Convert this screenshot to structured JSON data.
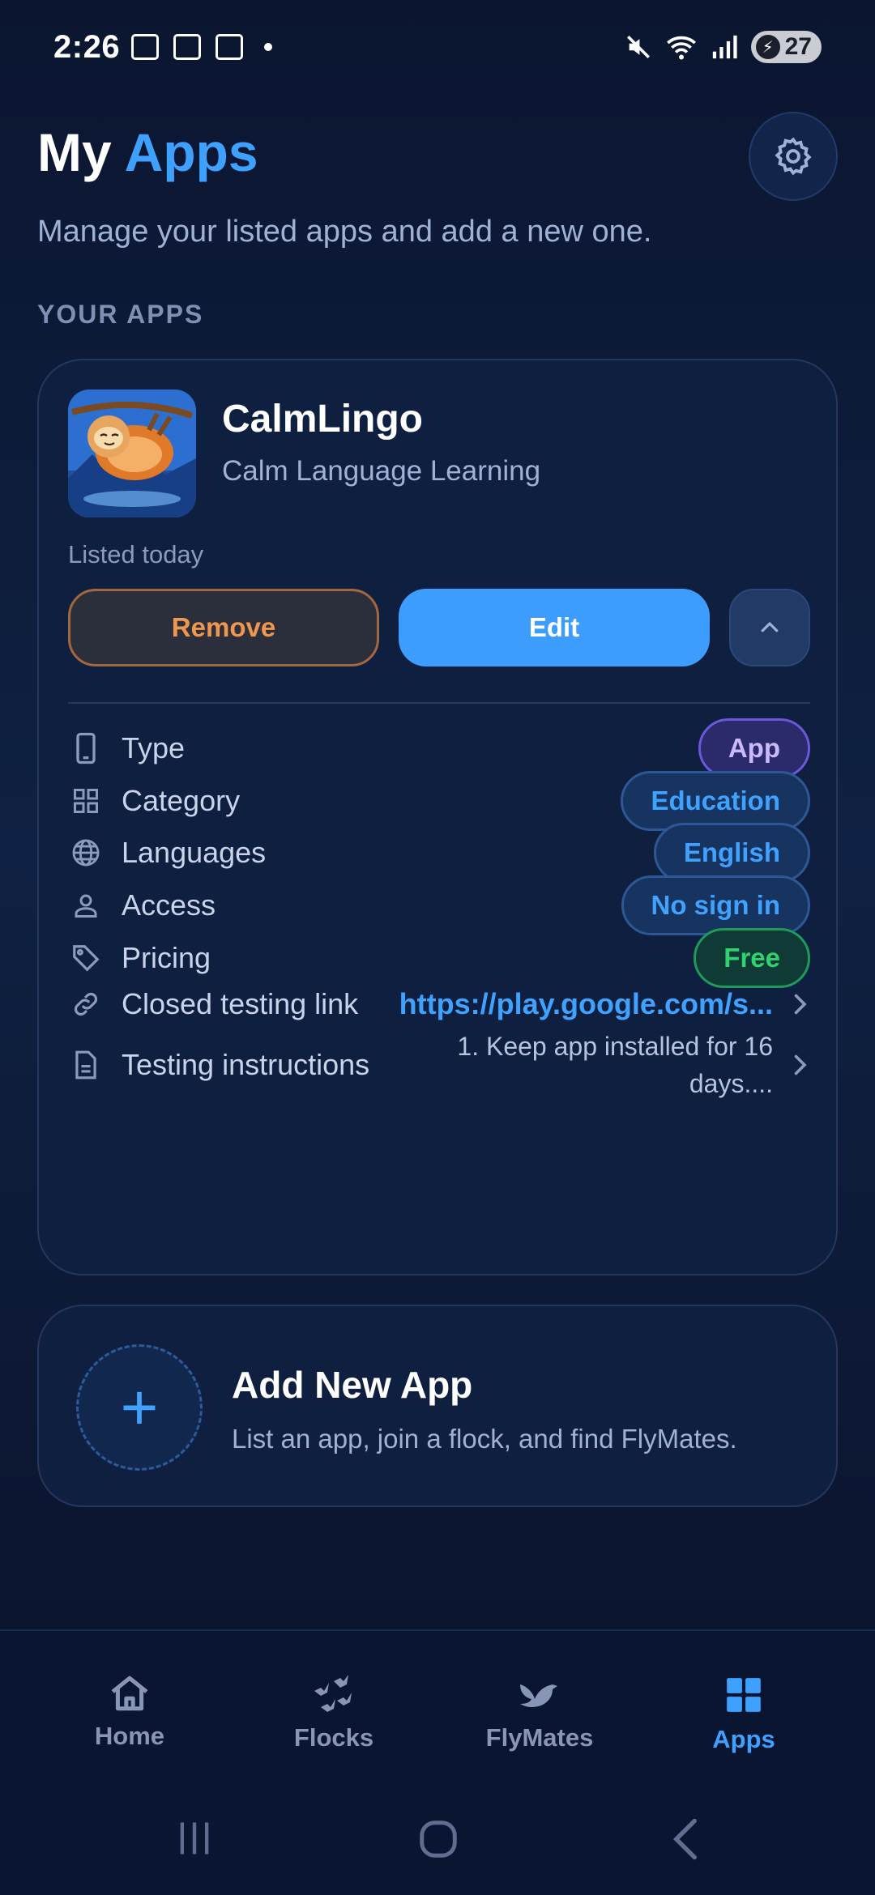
{
  "status_bar": {
    "time": "2:26",
    "battery": "27",
    "icons": [
      "screenshot-icon",
      "copy-icon",
      "calendar-icon",
      "notification-dot",
      "mute-icon",
      "wifi-icon",
      "signal-icon",
      "battery-icon"
    ]
  },
  "header": {
    "title_part1": "My",
    "title_part2": "Apps",
    "subtitle": "Manage your listed apps and add a new one.",
    "settings_icon": "gear-icon"
  },
  "section_label": "YOUR APPS",
  "app": {
    "name": "CalmLingo",
    "tagline": "Calm Language Learning",
    "listed": "Listed today",
    "remove_label": "Remove",
    "edit_label": "Edit",
    "details": {
      "type_label": "Type",
      "type_value": "App",
      "category_label": "Category",
      "category_value": "Education",
      "languages_label": "Languages",
      "languages_value": "English",
      "access_label": "Access",
      "access_value": "No sign in",
      "pricing_label": "Pricing",
      "pricing_value": "Free",
      "link_label": "Closed testing link",
      "link_value": "https://play.google.com/s...",
      "instructions_label": "Testing instructions",
      "instructions_value": "1. Keep app installed for 16 days...."
    }
  },
  "add_app": {
    "title": "Add New App",
    "description": "List an app, join a flock, and find FlyMates."
  },
  "nav": {
    "home": "Home",
    "flocks": "Flocks",
    "flymates": "FlyMates",
    "apps": "Apps",
    "active": "apps"
  },
  "colors": {
    "accent": "#3ea0ff",
    "remove": "#f0974f",
    "free": "#2fd36e",
    "type_pill": "#c9b9ff",
    "background": "#0b1530"
  }
}
